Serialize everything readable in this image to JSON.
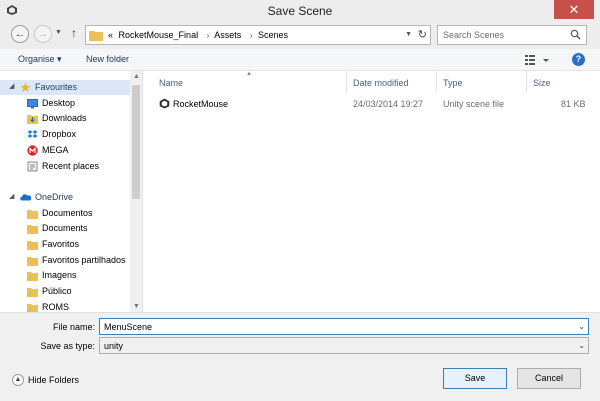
{
  "window": {
    "title": "Save Scene",
    "close_glyph": "✕",
    "app_icon": "unity-icon"
  },
  "nav": {
    "back_glyph": "←",
    "forward_glyph": "→",
    "up_glyph": "↑",
    "breadcrumbs": [
      "RocketMouse_Final",
      "Assets",
      "Scenes"
    ],
    "overflow_glyph": "«",
    "separator_glyph": "›",
    "refresh_glyph": "↻"
  },
  "search": {
    "placeholder": "Search Scenes"
  },
  "toolbar": {
    "organise_label": "Organise ▾",
    "new_folder_label": "New folder",
    "help_glyph": "?"
  },
  "sidebar": {
    "favourites": {
      "label": "Favourites",
      "items": [
        "Desktop",
        "Downloads",
        "Dropbox",
        "MEGA",
        "Recent places"
      ]
    },
    "onedrive": {
      "label": "OneDrive",
      "items": [
        "Documentos",
        "Documents",
        "Favoritos",
        "Favoritos partilhados",
        "Imagens",
        "Público",
        "ROMS"
      ]
    }
  },
  "columns": {
    "name": "Name",
    "date": "Date modified",
    "type": "Type",
    "size": "Size"
  },
  "files": [
    {
      "name": "RocketMouse",
      "date": "24/03/2014 19:27",
      "type": "Unity scene file",
      "size": "81 KB"
    }
  ],
  "form": {
    "file_name_label": "File name:",
    "file_name_value": "MenuScene",
    "save_type_label": "Save as type:",
    "save_type_value": "unity",
    "hide_folders_label": "Hide Folders",
    "save_label": "Save",
    "cancel_label": "Cancel"
  },
  "colors": {
    "accent": "#3c7fb1",
    "close": "#c7504b",
    "folder": "#e8c15b",
    "link": "#1e395b"
  }
}
